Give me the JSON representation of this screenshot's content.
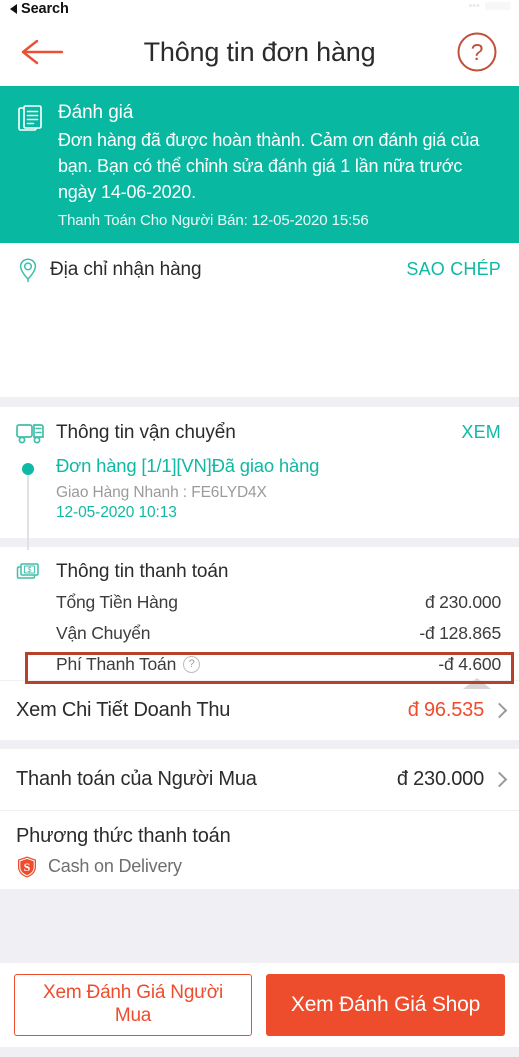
{
  "statusbar": {
    "back_to_app": "Search"
  },
  "navbar": {
    "title": "Thông tin đơn hàng",
    "back_icon": "back-arrow-icon",
    "help_icon": "help-circle-icon"
  },
  "review_banner": {
    "icon": "document-stack-icon",
    "title": "Đánh giá",
    "description": "Đơn hàng đã được hoàn thành. Cảm ơn đánh giá của bạn. Bạn có thể chỉnh sửa đánh giá 1 lần nữa trước ngày 14-06-2020.",
    "subtext": "Thanh Toán Cho Người Bán: 12-05-2020 15:56",
    "background_color": "#08b8a1"
  },
  "address": {
    "icon": "location-pin-icon",
    "title": "Địa chỉ nhận hàng",
    "copy_label": "SAO CHÉP"
  },
  "shipping": {
    "icon": "delivery-truck-icon",
    "title": "Thông tin vận chuyển",
    "view_label": "XEM",
    "status": "Đơn hàng [1/1][VN]Đã giao hàng",
    "carrier": "Giao Hàng Nhanh :  FE6LYD4X",
    "timestamp": "12-05-2020 10:13"
  },
  "payment_info": {
    "icon": "money-stack-icon",
    "title": "Thông tin thanh toán",
    "rows": [
      {
        "label": "Tổng Tiền Hàng",
        "value": "đ 230.000",
        "has_info": false,
        "highlighted": false
      },
      {
        "label": "Vận Chuyển",
        "value": "-đ 128.865",
        "has_info": false,
        "highlighted": false
      },
      {
        "label": "Phí Thanh Toán",
        "value": "-đ 4.600",
        "has_info": true,
        "highlighted": true
      }
    ],
    "highlight_color": "#b8412c"
  },
  "revenue": {
    "label": "Xem Chi Tiết Doanh Thu",
    "value": "đ 96.535"
  },
  "buyer_payment": {
    "label": "Thanh toán của Người Mua",
    "value": "đ 230.000"
  },
  "payment_method": {
    "title": "Phương thức thanh toán",
    "icon": "shopee-shield-icon",
    "name": "Cash on Delivery"
  },
  "actions": {
    "secondary_label": "Xem Đánh Giá Người Mua",
    "primary_label": "Xem Đánh Giá Shop",
    "accent_color": "#ee4d2d"
  }
}
